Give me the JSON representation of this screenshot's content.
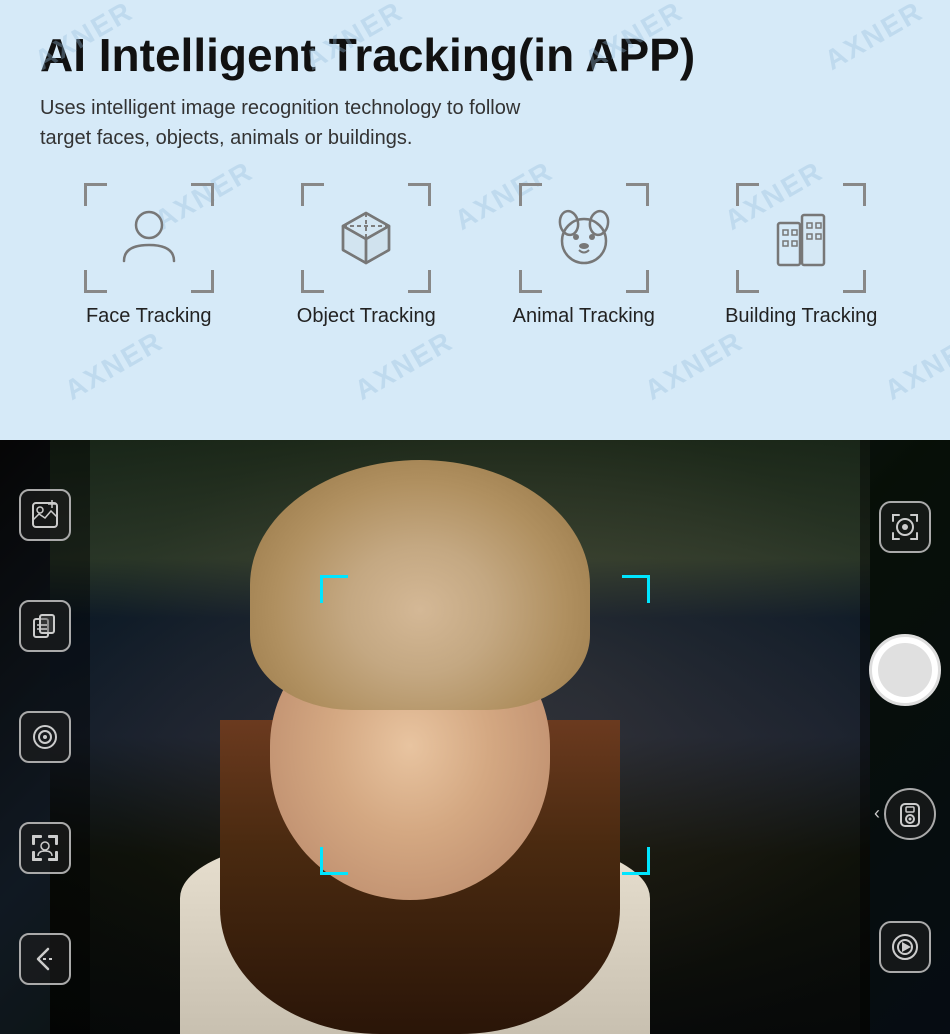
{
  "top": {
    "title": "AI Intelligent Tracking(in APP)",
    "subtitle_line1": "Uses intelligent image recognition technology to follow",
    "subtitle_line2": "target faces, objects, animals or buildings.",
    "watermarks": [
      "AXNER",
      "AXNER",
      "AXNER",
      "AXNER",
      "AXNER",
      "AXNER",
      "AXNER",
      "AXNER"
    ],
    "tracking_items": [
      {
        "id": "face",
        "label": "Face Tracking"
      },
      {
        "id": "object",
        "label": "Object Tracking"
      },
      {
        "id": "animal",
        "label": "Animal Tracking"
      },
      {
        "id": "building",
        "label": "Building Tracking"
      }
    ]
  },
  "bottom": {
    "left_icons": [
      {
        "id": "gallery",
        "symbol": "⊞"
      },
      {
        "id": "settings2",
        "symbol": "⊟"
      },
      {
        "id": "camera",
        "symbol": "◎"
      },
      {
        "id": "face-detect",
        "symbol": "⊙"
      },
      {
        "id": "back",
        "symbol": "◁"
      }
    ],
    "right_icons": [
      {
        "id": "track-mode",
        "symbol": "◎"
      },
      {
        "id": "shutter",
        "label": ""
      },
      {
        "id": "flip",
        "symbol": "↔"
      },
      {
        "id": "video",
        "symbol": "▶"
      }
    ]
  }
}
